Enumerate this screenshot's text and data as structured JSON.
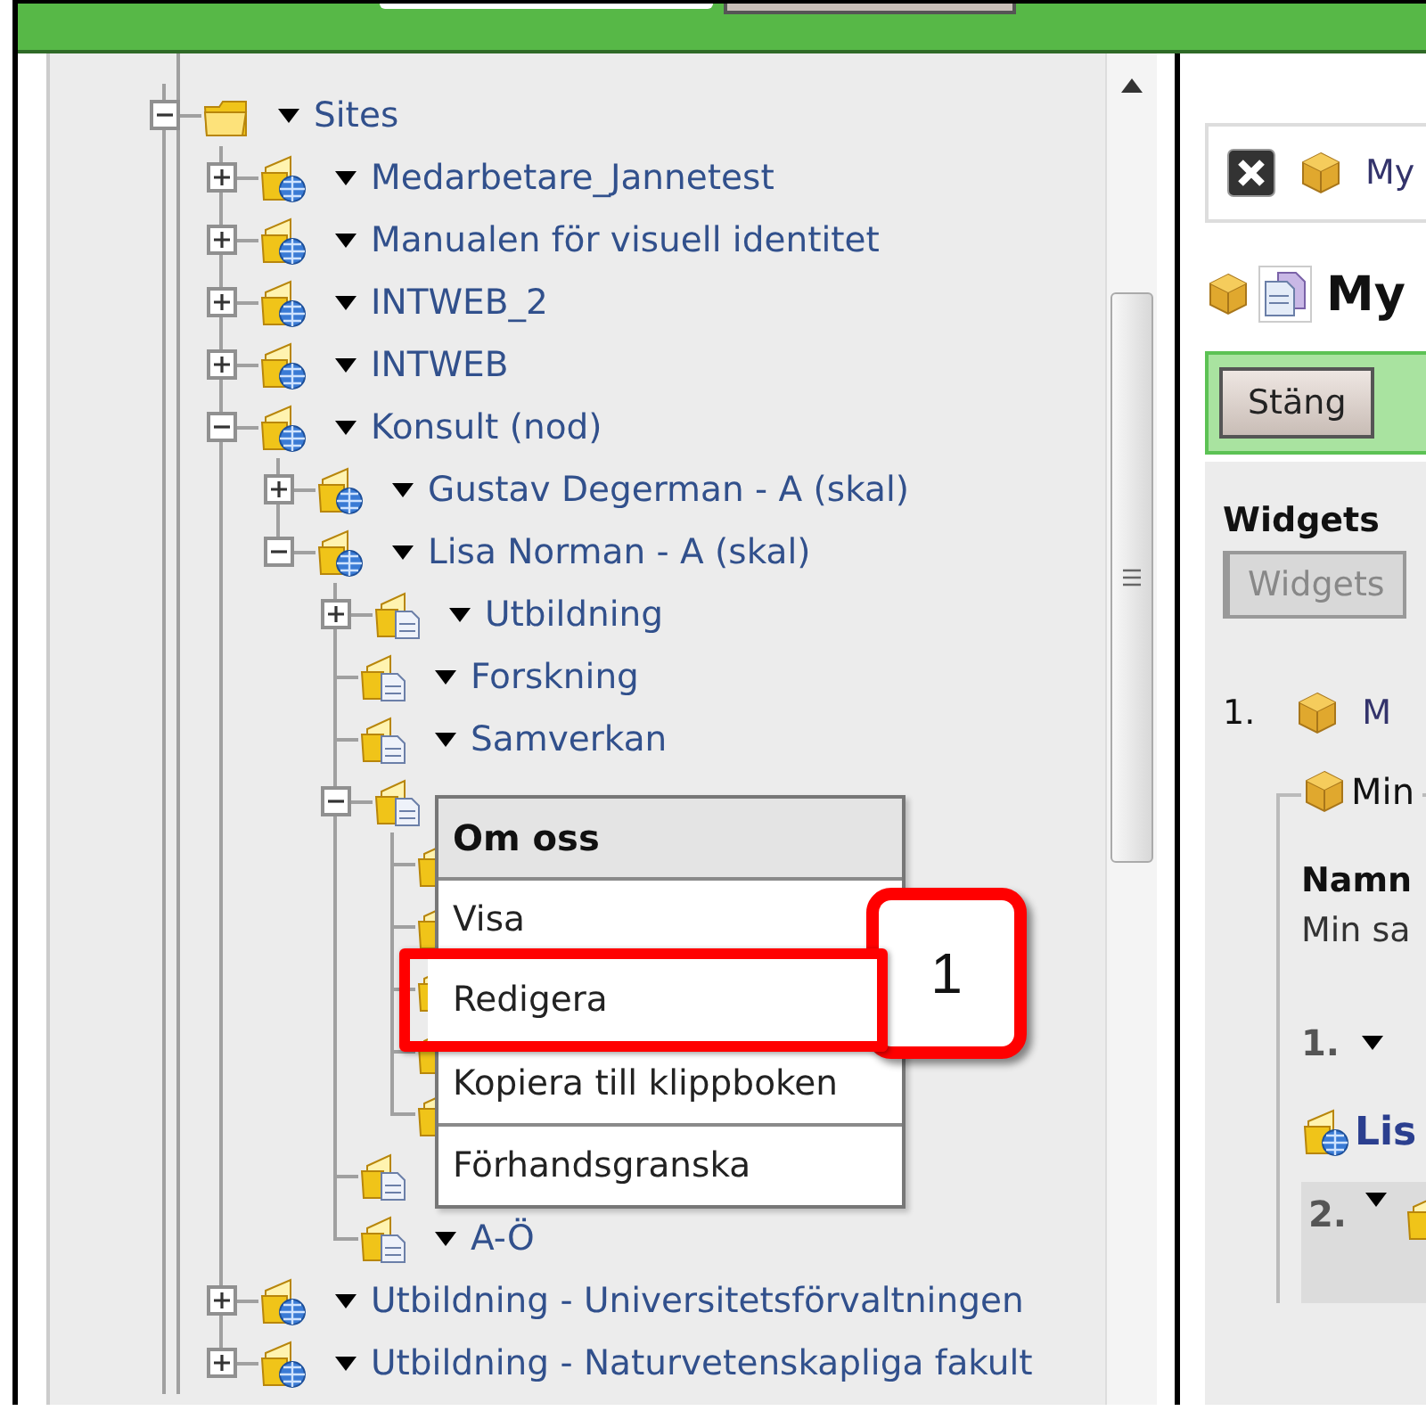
{
  "tree": {
    "nodes": [
      {
        "kind": "folder",
        "label": "Sites",
        "expanded": true,
        "children": [
          {
            "kind": "site",
            "label": "Medarbetare_Jannetest",
            "expanded": false
          },
          {
            "kind": "site",
            "label": "Manualen för visuell identitet",
            "expanded": false
          },
          {
            "kind": "site",
            "label": "INTWEB_2",
            "expanded": false
          },
          {
            "kind": "site",
            "label": "INTWEB",
            "expanded": false
          },
          {
            "kind": "site",
            "label": "Konsult (nod)",
            "expanded": true,
            "children": [
              {
                "kind": "site",
                "label": "Gustav Degerman - A (skal)",
                "expanded": false
              },
              {
                "kind": "site",
                "label": "Lisa Norman - A (skal)",
                "expanded": true,
                "children": [
                  {
                    "kind": "page",
                    "label": "Utbildning",
                    "expanded": false
                  },
                  {
                    "kind": "page",
                    "label": "Forskning"
                  },
                  {
                    "kind": "page",
                    "label": "Samverkan"
                  },
                  {
                    "kind": "page",
                    "expanded": true,
                    "children": [
                      {
                        "kind": "page"
                      },
                      {
                        "kind": "page"
                      },
                      {
                        "kind": "page"
                      },
                      {
                        "kind": "page"
                      },
                      {
                        "kind": "page"
                      }
                    ]
                  },
                  {
                    "kind": "page"
                  },
                  {
                    "kind": "page",
                    "label": "A-Ö"
                  }
                ]
              }
            ]
          },
          {
            "kind": "site",
            "label": "Utbildning - Universitetsförvaltningen",
            "expanded": false
          },
          {
            "kind": "site",
            "label": "Utbildning - Naturvetenskapliga fakult",
            "expanded": false
          }
        ]
      }
    ]
  },
  "context_menu": {
    "title": "Om oss",
    "items": [
      {
        "label": "Visa",
        "highlighted": false
      },
      {
        "label": "Redigera",
        "highlighted": true
      },
      {
        "label": "Kopiera till klippboken",
        "highlighted": false
      },
      {
        "label": "Förhandsgranska",
        "highlighted": false
      }
    ],
    "callout": "1"
  },
  "editor": {
    "tab": "My",
    "title": "My",
    "toolbar": [
      "Stäng"
    ],
    "widgets": {
      "heading": "Widgets",
      "tab": "Widgets"
    },
    "item": {
      "number": "1.",
      "link": "M"
    },
    "group": {
      "legend": "Min",
      "name_label": "Namn",
      "name_value": "Min sa",
      "sub_number": "1.",
      "link": "Lis",
      "shaded_number": "2."
    }
  }
}
